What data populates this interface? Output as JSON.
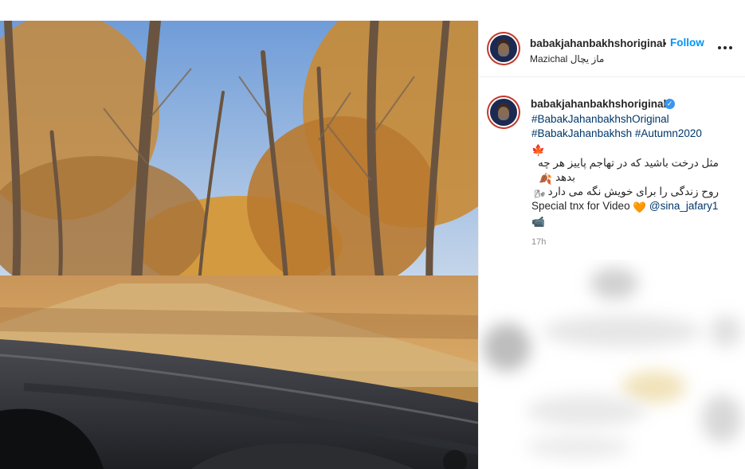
{
  "post": {
    "author": "babakjahanbakhshoriginal",
    "follow_label": "Follow",
    "separator": "•",
    "location": "Mazichal ماز یچال",
    "verified_symbol": "✓"
  },
  "caption": {
    "author": "babakjahanbakhshoriginal",
    "hashtags_line1": "#BabakJahanbakhshOriginal",
    "hashtags_line2": "#BabakJahanbakhsh #Autumn2020",
    "emoji_leaf": "🍁",
    "persian_line1": "مثل درخت باشید که در تهاجم پاییز هر چه",
    "persian_line2": "بدهد",
    "emoji_line2": "🍂",
    "persian_line3": "روح زندگی را برای خویش نگه می دارد",
    "emoji_line3": "🌬",
    "credit_text": "Special tnx for Video",
    "emoji_heart": "🧡",
    "mention": "@sina_jafary1",
    "emoji_camera": "📹",
    "time": "17h"
  },
  "icons": {
    "more_options": "more-horizontal-icon",
    "verified": "verified-badge-icon"
  },
  "colors": {
    "link_blue": "#0095f6",
    "tag_color": "#00376b",
    "verified_blue": "#3897f0",
    "muted": "#8e8e8e"
  }
}
